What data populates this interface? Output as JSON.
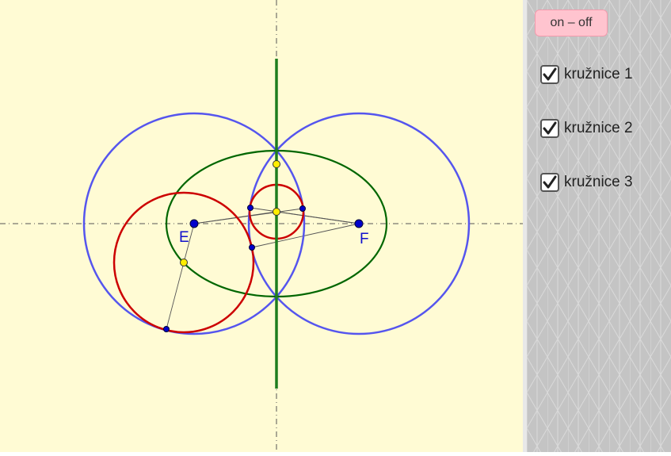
{
  "colors": {
    "canvas_bg": "#fffbd4",
    "panel_bg": "#c4c4c4",
    "circle_blue": "#5555ee",
    "circle_red": "#cc0000",
    "ellipse_green": "#006600",
    "axis_line": "#1e7d1e",
    "point_blue": "#0000cc",
    "point_yellow": "#ffee00",
    "button_bg": "#ffc4cf"
  },
  "labels": {
    "point_e": "E",
    "point_f": "F"
  },
  "panel": {
    "toggle_button": "on – off",
    "checkboxes": [
      {
        "label": "kružnice 1",
        "checked": true
      },
      {
        "label": "kružnice 2",
        "checked": true
      },
      {
        "label": "kružnice 3",
        "checked": true
      }
    ]
  }
}
